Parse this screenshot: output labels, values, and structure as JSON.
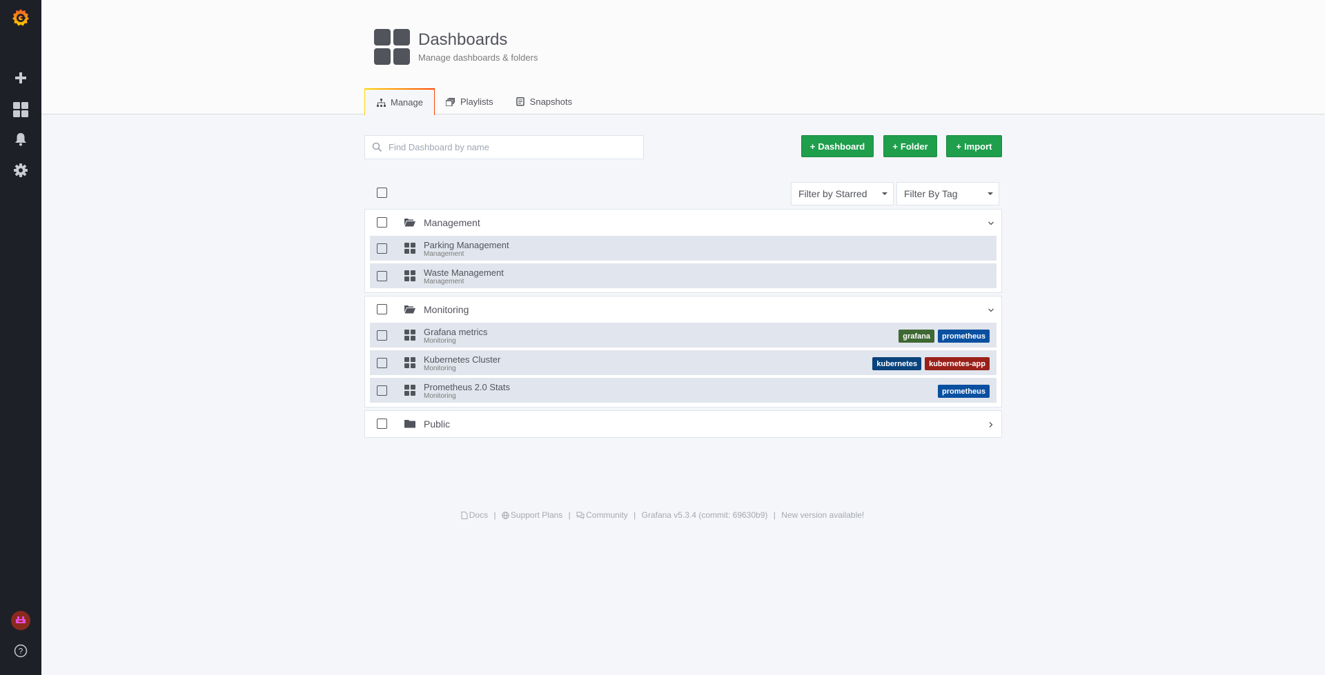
{
  "sidebar": {
    "items": [
      {
        "name": "grafana-logo-icon"
      },
      {
        "name": "plus-icon"
      },
      {
        "name": "dashboards-icon"
      },
      {
        "name": "bell-icon"
      },
      {
        "name": "gear-icon"
      },
      {
        "name": "avatar"
      },
      {
        "name": "help-icon"
      }
    ],
    "accent": "#f05a28"
  },
  "header": {
    "title": "Dashboards",
    "subtitle": "Manage dashboards & folders"
  },
  "tabs": [
    {
      "label": "Manage",
      "icon": "sitemap-icon",
      "active": true
    },
    {
      "label": "Playlists",
      "icon": "playlist-icon",
      "active": false
    },
    {
      "label": "Snapshots",
      "icon": "snapshot-icon",
      "active": false
    }
  ],
  "search": {
    "placeholder": "Find Dashboard by name",
    "value": ""
  },
  "actions": {
    "dashboard": "Dashboard",
    "folder": "Folder",
    "import": "Import",
    "color": "#1f9e4c"
  },
  "filters": {
    "starred": "Filter by Starred",
    "tag": "Filter By Tag"
  },
  "sections": [
    {
      "title": "Management",
      "expanded": true,
      "items": [
        {
          "title": "Parking Management",
          "folder": "Management",
          "tags": []
        },
        {
          "title": "Waste Management",
          "folder": "Management",
          "tags": []
        }
      ]
    },
    {
      "title": "Monitoring",
      "expanded": true,
      "items": [
        {
          "title": "Grafana metrics",
          "folder": "Monitoring",
          "tags": [
            {
              "label": "grafana",
              "color": "#3f6833"
            },
            {
              "label": "prometheus",
              "color": "#0a50a1"
            }
          ]
        },
        {
          "title": "Kubernetes Cluster",
          "folder": "Monitoring",
          "tags": [
            {
              "label": "kubernetes",
              "color": "#0a437c"
            },
            {
              "label": "kubernetes-app",
              "color": "#99211a"
            }
          ]
        },
        {
          "title": "Prometheus 2.0 Stats",
          "folder": "Monitoring",
          "tags": [
            {
              "label": "prometheus",
              "color": "#0a50a1"
            }
          ]
        }
      ]
    },
    {
      "title": "Public",
      "expanded": false,
      "items": []
    }
  ],
  "footer": {
    "docs": "Docs",
    "support": "Support Plans",
    "community": "Community",
    "version": "Grafana v5.3.4 (commit: 69630b9)",
    "update": "New version available!"
  }
}
